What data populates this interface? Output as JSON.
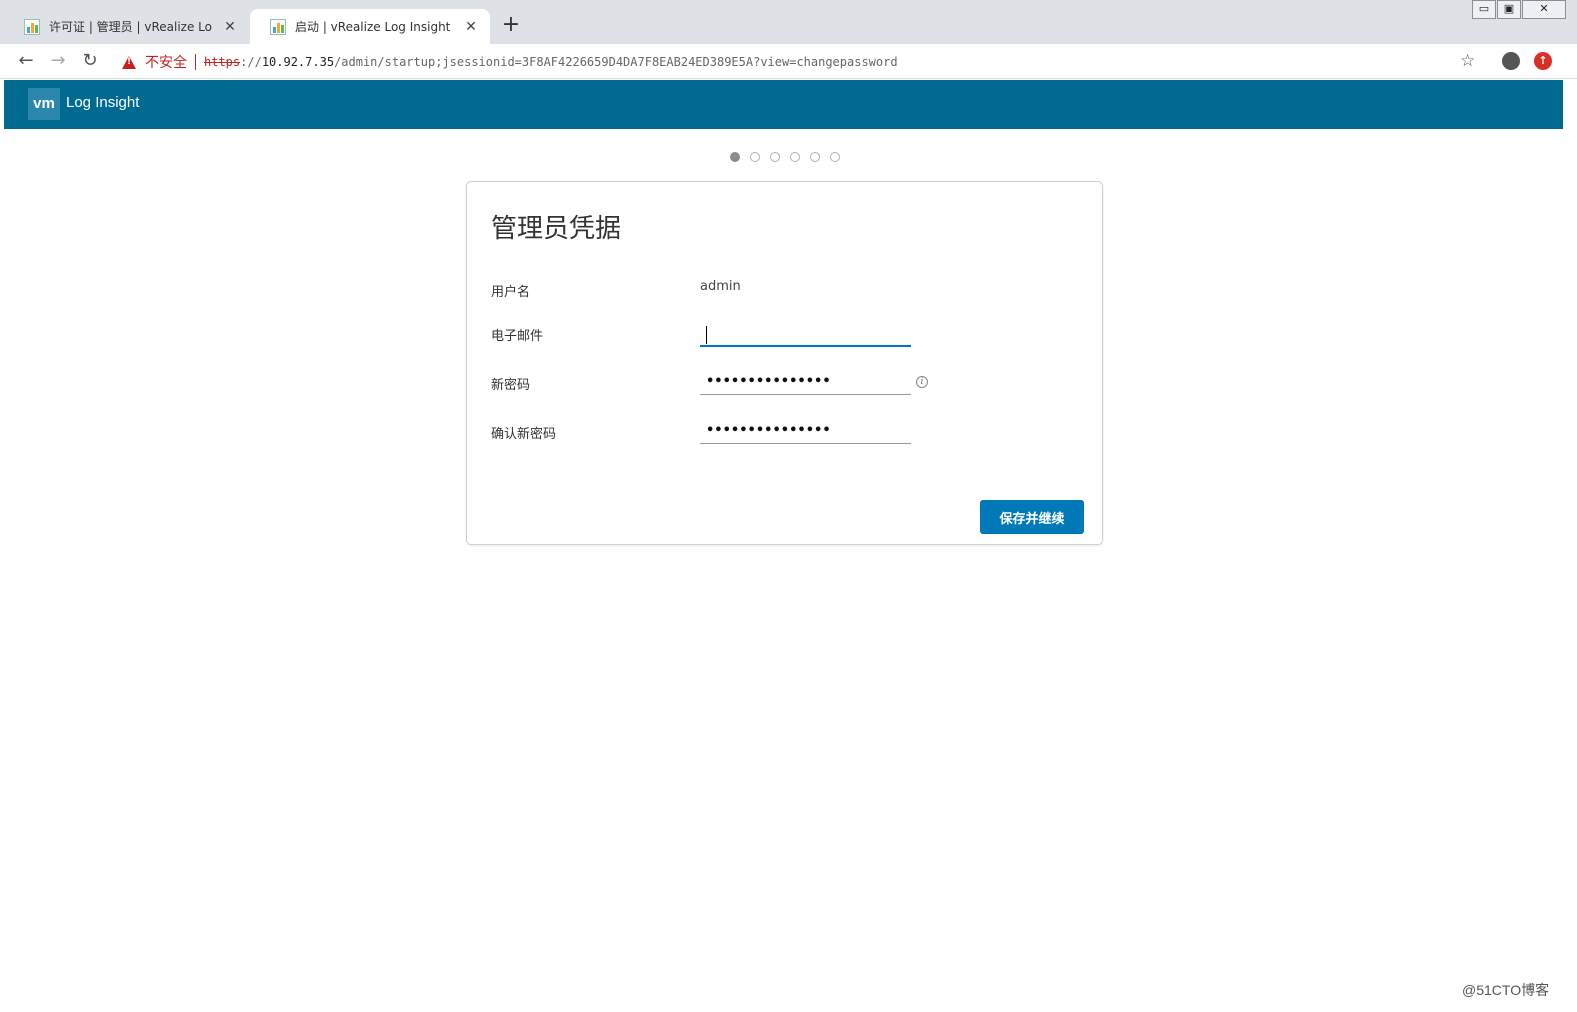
{
  "browser": {
    "tabs": [
      {
        "title": "许可证 | 管理员 | vRealize Lo",
        "active": false
      },
      {
        "title": "启动 | vRealize Log Insight",
        "active": true
      }
    ],
    "new_tab": "+",
    "window_controls": {
      "minimize": "▭",
      "restore": "▣",
      "close": "✕"
    },
    "nav": {
      "back": "←",
      "forward": "→",
      "reload": "↻"
    },
    "security_label": "不安全",
    "url": {
      "scheme": "https",
      "sep": "://",
      "host": "10.92.7.35",
      "path": "/admin/startup;jsessionid=3F8AF4226659D4DA7F8EAB24ED389E5A?view=changepassword"
    },
    "bookmark_icon": "☆",
    "update_icon": "↑"
  },
  "app": {
    "logo": "vm",
    "name": "Log Insight"
  },
  "stepper": {
    "total": 6,
    "current": 1
  },
  "form": {
    "title": "管理员凭据",
    "username_label": "用户名",
    "username_value": "admin",
    "email_label": "电子邮件",
    "email_value": "",
    "new_password_label": "新密码",
    "new_password_mask": "•••••••••••••••",
    "confirm_password_label": "确认新密码",
    "confirm_password_mask": "•••••••••••••••",
    "info_icon": "i",
    "submit_label": "保存并继续"
  },
  "watermark": "@51CTO博客",
  "colors": {
    "header_bg": "#006a91",
    "primary": "#0079b8",
    "warning": "#c5221f"
  }
}
